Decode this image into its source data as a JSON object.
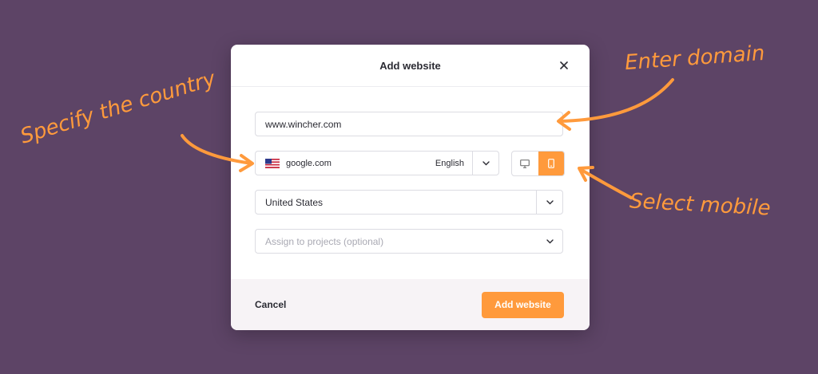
{
  "modal": {
    "title": "Add website",
    "close_icon": "close-icon"
  },
  "form": {
    "domain_value": "www.wincher.com",
    "search_engine": {
      "flag_icon": "us-flag-icon",
      "domain": "google.com",
      "language": "English"
    },
    "devices": {
      "desktop_icon": "desktop-icon",
      "mobile_icon": "mobile-icon",
      "selected": "mobile"
    },
    "country_value": "United States",
    "projects_placeholder": "Assign to projects (optional)"
  },
  "footer": {
    "cancel_label": "Cancel",
    "submit_label": "Add website"
  },
  "annotations": {
    "country": "Specify the country",
    "domain": "Enter domain",
    "mobile": "Select mobile"
  },
  "colors": {
    "background": "#5d4466",
    "accent": "#ff9a3c"
  }
}
